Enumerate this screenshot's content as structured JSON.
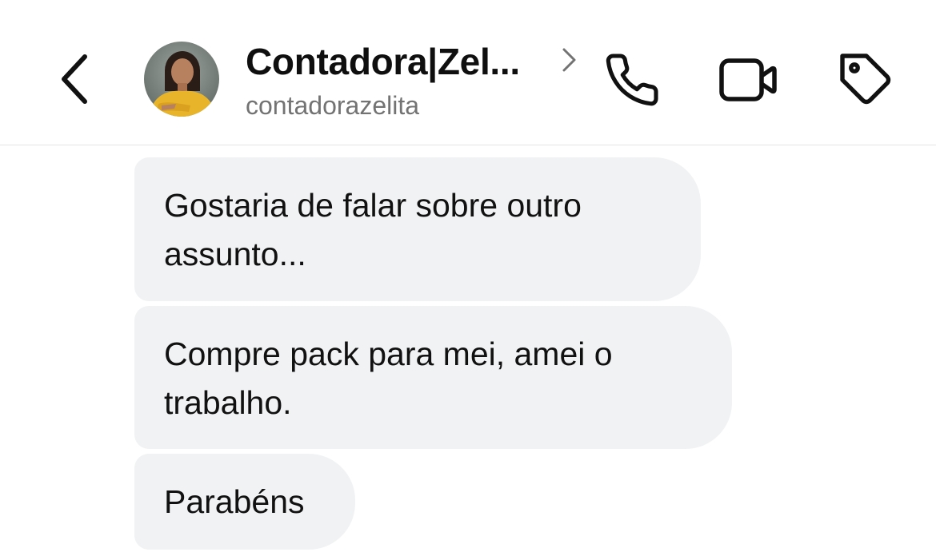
{
  "header": {
    "contact_name": "Contadora|Zel...",
    "contact_handle": "contadorazelita",
    "icons": {
      "back": "chevron-left-icon",
      "profile_link": "chevron-right-icon",
      "call": "phone-icon",
      "video": "video-camera-icon",
      "label": "tag-icon"
    }
  },
  "messages": [
    {
      "sender": "them",
      "text": "Gostaria de falar sobre outro assunto..."
    },
    {
      "sender": "them",
      "text": "Compre pack para mei, amei o trabalho."
    },
    {
      "sender": "them",
      "text": "Parabéns"
    }
  ],
  "colors": {
    "bubble_background": "#f1f2f4",
    "handle_text": "#737373",
    "header_divider": "#e4e4e4",
    "avatar_shirt": "#e8b52a"
  }
}
